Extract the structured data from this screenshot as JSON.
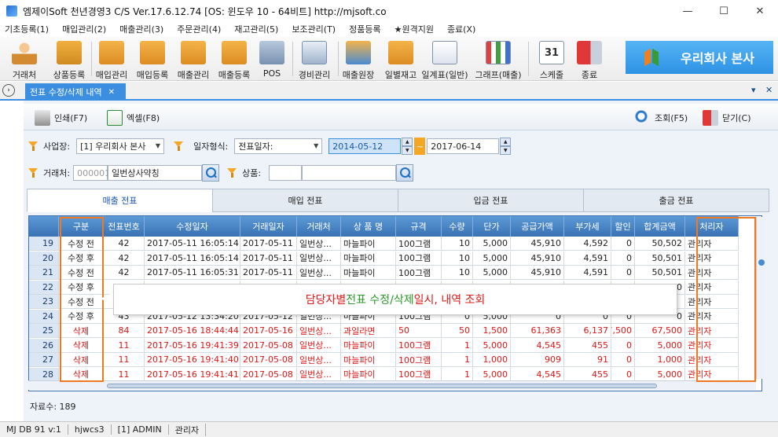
{
  "window": {
    "title": "엠제이Soft 천년경영3 C/S   Ver.17.6.12.74   [OS: 윈도우 10 - 64비트]   http://mjsoft.co",
    "minimize": "—",
    "maximize": "☐",
    "close": "✕"
  },
  "menu": [
    "기초등록(1)",
    "매입관리(2)",
    "매출관리(3)",
    "주문관리(4)",
    "재고관리(5)",
    "보조관리(T)",
    "정품등록",
    "★원격지원",
    "종료(X)"
  ],
  "toolbar": {
    "buttons": [
      "거래처",
      "상품등록",
      "매입관리",
      "매입등록",
      "매출관리",
      "매출등록",
      "POS",
      "경비관리",
      "매출원장",
      "일별재고",
      "일계표(일반)",
      "그래프(매출)",
      "스케줄",
      "종료"
    ],
    "schedule_day": "31",
    "company": "우리회사 본사"
  },
  "doc_tab": {
    "label": "전표 수정/삭제 내역",
    "close": "✕",
    "pin": "▾",
    "close_all": "✕",
    "side": "›"
  },
  "commands": {
    "print": "인쇄(F7)",
    "excel": "엑셀(F8)",
    "search": "조회(F5)",
    "close": "닫기(C)"
  },
  "filters": {
    "site_label": "사업장:",
    "site_value": "[1] 우리회사 본사",
    "date_type_label": "일자형식:",
    "date_type_value": "전표일자:",
    "date_from": "2014-05-12",
    "date_to": "2017-06-14",
    "tilde": "~",
    "client_label": "거래처:",
    "client_code_placeholder": "000001",
    "client_name": "일번상사약칭",
    "product_label": "상품:",
    "product_value": ""
  },
  "subtabs": [
    "매출 전표",
    "매입 전표",
    "입금 전표",
    "출금 전표"
  ],
  "grid": {
    "columns": [
      "구분",
      "전표번호",
      "수정일자",
      "거래일자",
      "거래처",
      "상 품 명",
      "규격",
      "수량",
      "단가",
      "공급가액",
      "부가세",
      "할인",
      "합계금액",
      "처리자"
    ],
    "rows": [
      {
        "n": "19",
        "type": "수정 전",
        "no": "42",
        "mod": "2017-05-11 16:05:14",
        "date": "2017-05-11",
        "client": "일번상...",
        "prod": "마늘파이",
        "spec": "100그램",
        "qty": "10",
        "price": "5,000",
        "supply": "45,910",
        "vat": "4,592",
        "disc": "0",
        "total": "50,502",
        "user": "관리자",
        "red": false
      },
      {
        "n": "20",
        "type": "수정 후",
        "no": "42",
        "mod": "2017-05-11 16:05:14",
        "date": "2017-05-11",
        "client": "일번상...",
        "prod": "마늘파이",
        "spec": "100그램",
        "qty": "10",
        "price": "5,000",
        "supply": "45,910",
        "vat": "4,591",
        "disc": "0",
        "total": "50,501",
        "user": "관리자",
        "red": false
      },
      {
        "n": "21",
        "type": "수정 전",
        "no": "42",
        "mod": "2017-05-11 16:05:31",
        "date": "2017-05-11",
        "client": "일번상...",
        "prod": "마늘파이",
        "spec": "100그램",
        "qty": "10",
        "price": "5,000",
        "supply": "45,910",
        "vat": "4,591",
        "disc": "0",
        "total": "50,501",
        "user": "관리자",
        "red": false
      },
      {
        "n": "22",
        "type": "수정 후",
        "no": "",
        "mod": "",
        "date": "",
        "client": "",
        "prod": "",
        "spec": "",
        "qty": "",
        "price": "",
        "supply": "",
        "vat": "",
        "disc": "",
        "total": "00",
        "user": "관리자",
        "red": false
      },
      {
        "n": "23",
        "type": "수정 전",
        "no": "",
        "mod": "",
        "date": "",
        "client": "",
        "prod": "",
        "spec": "",
        "qty": "",
        "price": "",
        "supply": "",
        "vat": "",
        "disc": "",
        "total": "",
        "user": "관리자",
        "red": false
      },
      {
        "n": "24",
        "type": "수정 후",
        "no": "43",
        "mod": "2017-05-12 13:34:20",
        "date": "2017-05-12",
        "client": "일번상...",
        "prod": "마늘파이",
        "spec": "100그램",
        "qty": "0",
        "price": "5,000",
        "supply": "0",
        "vat": "0",
        "disc": "0",
        "total": "0",
        "user": "관리자",
        "red": false
      },
      {
        "n": "25",
        "type": "삭제",
        "no": "84",
        "mod": "2017-05-16 18:44:44",
        "date": "2017-05-16",
        "client": "일번상...",
        "prod": "과일라면",
        "spec": "50",
        "qty": "50",
        "price": "1,500",
        "supply": "61,363",
        "vat": "6,137",
        "disc": "7,500",
        "total": "67,500",
        "user": "관리자",
        "red": true
      },
      {
        "n": "26",
        "type": "삭제",
        "no": "11",
        "mod": "2017-05-16 19:41:39",
        "date": "2017-05-08",
        "client": "일번상...",
        "prod": "마늘파이",
        "spec": "100그램",
        "qty": "1",
        "price": "5,000",
        "supply": "4,545",
        "vat": "455",
        "disc": "0",
        "total": "5,000",
        "user": "관리자",
        "red": true
      },
      {
        "n": "27",
        "type": "삭제",
        "no": "11",
        "mod": "2017-05-16 19:41:40",
        "date": "2017-05-08",
        "client": "일번상...",
        "prod": "마늘파이",
        "spec": "100그램",
        "qty": "1",
        "price": "1,000",
        "supply": "909",
        "vat": "91",
        "disc": "0",
        "total": "1,000",
        "user": "관리자",
        "red": true
      },
      {
        "n": "28",
        "type": "삭제",
        "no": "11",
        "mod": "2017-05-16 19:41:41",
        "date": "2017-05-08",
        "client": "일번상...",
        "prod": "마늘파이",
        "spec": "100그램",
        "qty": "1",
        "price": "5,000",
        "supply": "4,545",
        "vat": "455",
        "disc": "0",
        "total": "5,000",
        "user": "관리자",
        "red": true
      }
    ]
  },
  "callout": {
    "part1": "담당자별 ",
    "part2": "전표 수정/삭제 ",
    "part3": "일시, 내역 조회",
    "color1": "#e01818",
    "color2": "#2a9a2a"
  },
  "record_count": "자료수: 189",
  "statusbar": [
    "MJ DB 91 v:1",
    "hjwcs3",
    "[1] ADMIN",
    "관리자"
  ]
}
